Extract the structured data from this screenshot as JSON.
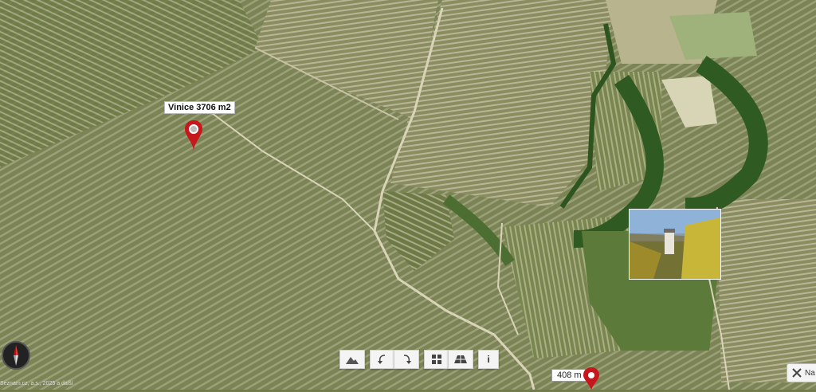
{
  "marker": {
    "label": "Vinice 3706 m2"
  },
  "scale": {
    "label": "408 m"
  },
  "toolbar": {
    "info_label": "i"
  },
  "navigation": {
    "label": "Na"
  },
  "copyright": {
    "text": "Seznam.cz, a.s., 2025 a další"
  },
  "colors": {
    "marker_red": "#c8161d",
    "toolbar_bg": "#f4f4f4",
    "terrain_green": "#6f7d4a"
  },
  "icons": [
    "compass-icon",
    "terrain-icon",
    "rotate-left-icon",
    "rotate-right-icon",
    "grid-icon",
    "perspective-icon",
    "info-icon",
    "map-pin-icon",
    "tools-icon"
  ]
}
